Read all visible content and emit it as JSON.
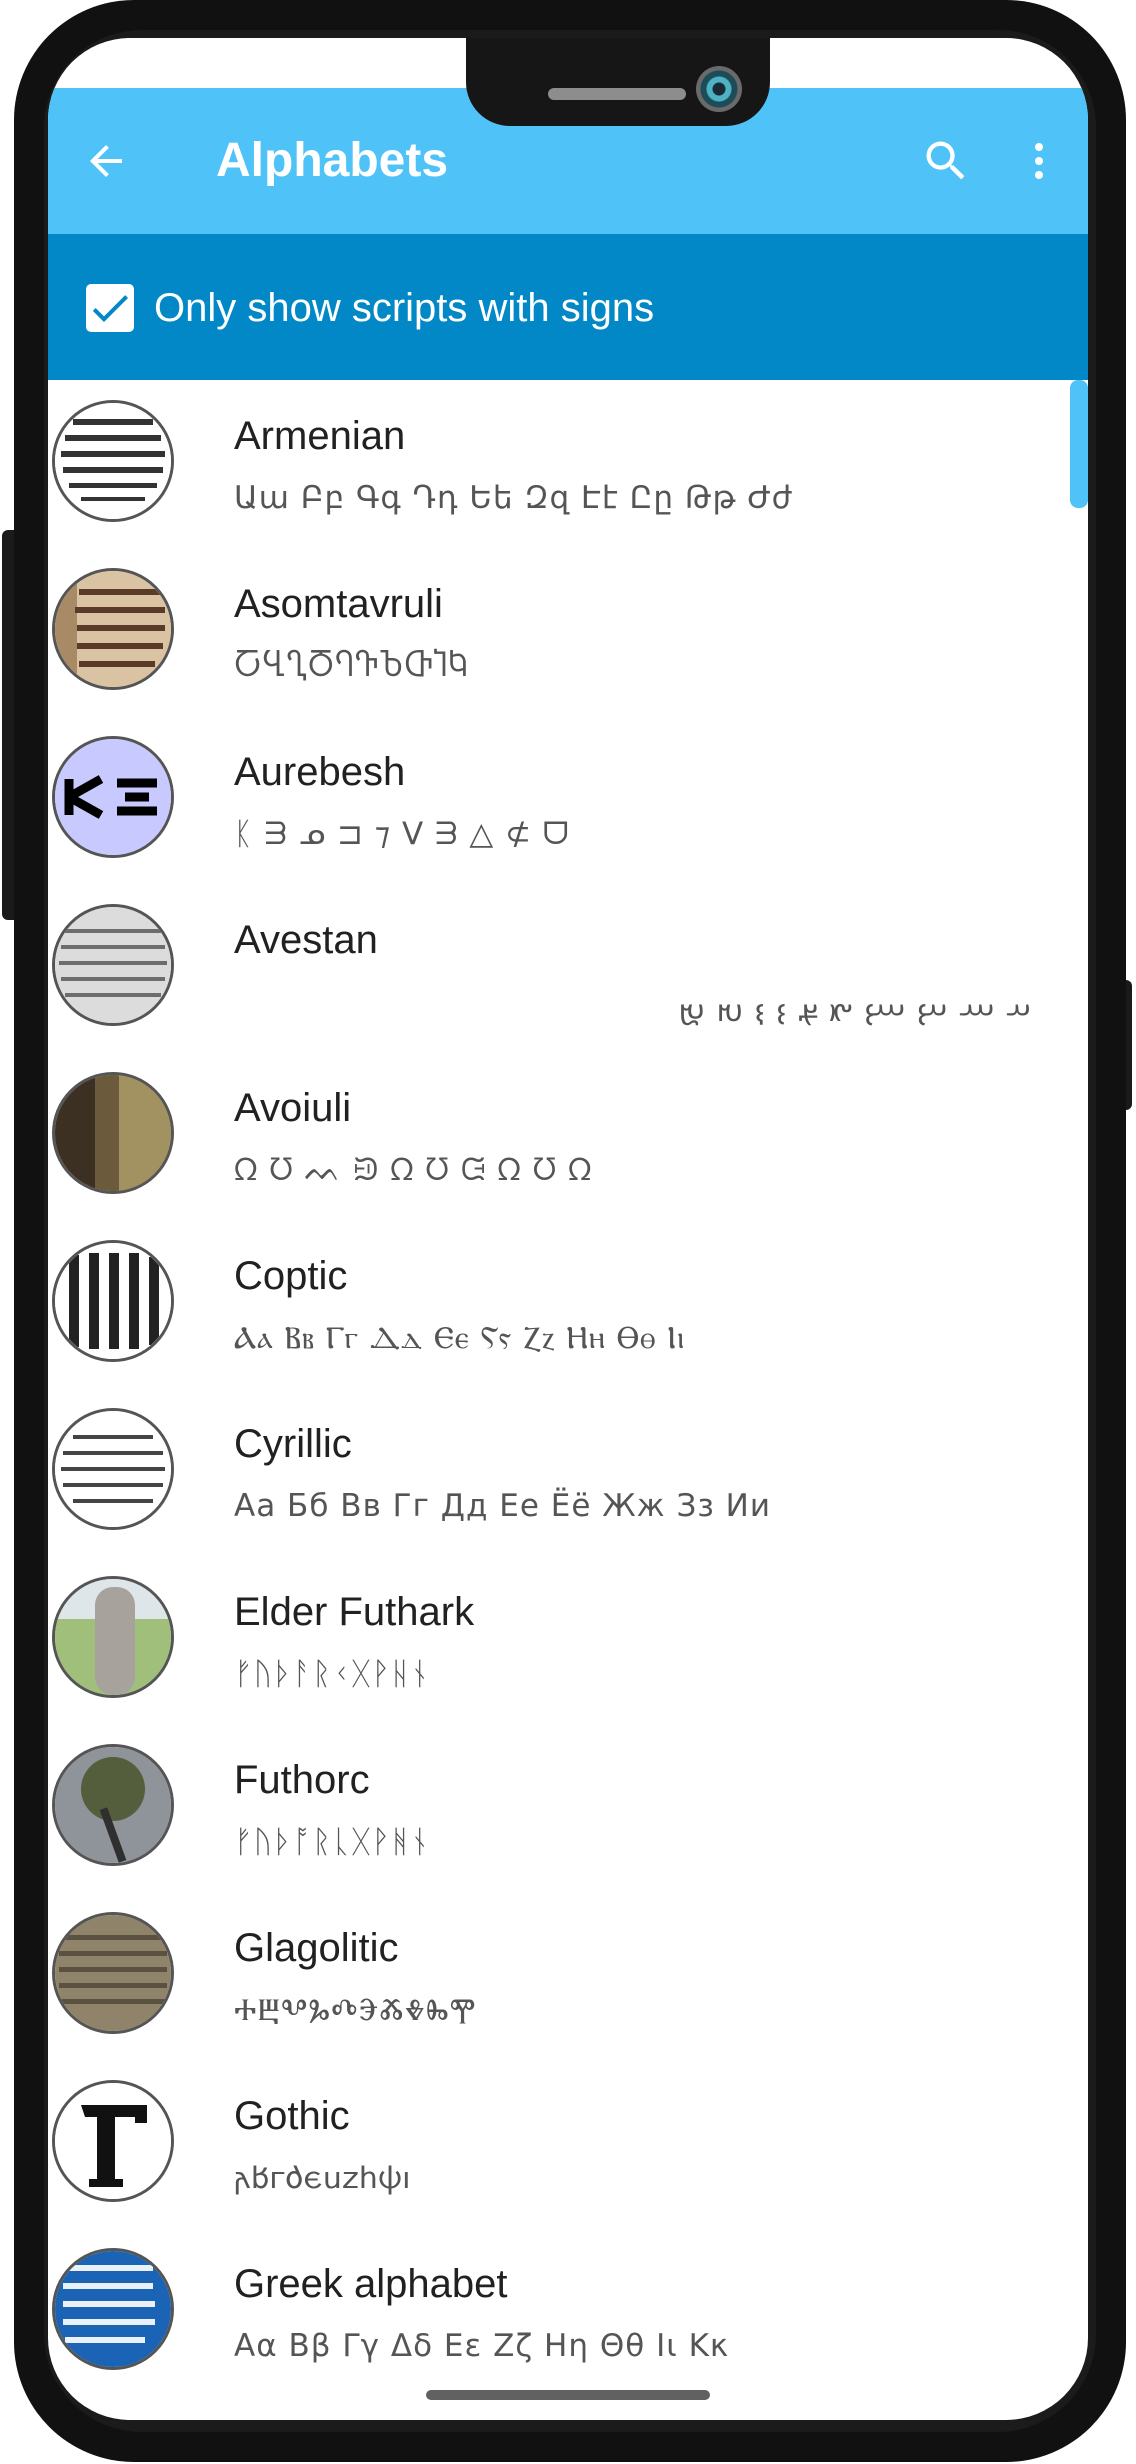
{
  "appbar": {
    "title": "Alphabets",
    "back_icon": "arrow-back-icon",
    "search_icon": "search-icon",
    "more_icon": "more-vert-icon",
    "color": "#4fc3f7"
  },
  "filter": {
    "label": "Only show scripts with signs",
    "checked": true,
    "color": "#0288c7"
  },
  "scripts": [
    {
      "name": "Armenian",
      "sample": "Աա Բբ Գգ Դդ Եե Զզ Էէ Ըը Թթ Ժժ"
    },
    {
      "name": "Asomtavruli",
      "sample": "ႠႡႢႣႤႥႦႧႨႩ"
    },
    {
      "name": "Aurebesh",
      "sample": "ᛕ ᗱ ᓄ ⊐ ⁊ ᐯ ᗱ △ ⊄ ᗜ"
    },
    {
      "name": "Avestan",
      "sample": "𐬀 𐬁 𐬂 𐬃 𐬄 𐬅 𐬆 𐬇 𐬈 𐬉"
    },
    {
      "name": "Avoiuli",
      "sample": "ᘯ ᘮ ᨓ ᙋ ᘯ ᘮ ᙍ ᘯ ᘮ ᘯ"
    },
    {
      "name": "Coptic",
      "sample": "Ⲁⲁ Ⲃⲃ Ⲅⲅ Ⲇⲇ Ⲉⲉ Ⲋⲋ Ⲍⲍ Ⲏⲏ Ⲑⲑ Ⲓⲓ"
    },
    {
      "name": "Cyrillic",
      "sample": "Аа Бб Вв Гг Дд Ее Ёё Жж Зз Ии"
    },
    {
      "name": "Elder Futhark",
      "sample": "ᚠᚢᚦᚨᚱᚲᚷᚹᚺᚾ"
    },
    {
      "name": "Futhorc",
      "sample": "ᚠᚢᚦᚩᚱᚳᚷᚹᚻᚾ"
    },
    {
      "name": "Glagolitic",
      "sample": "ⰀⰁⰂⰃⰄⰅⰆⰇⰈⰉ"
    },
    {
      "name": "Gothic",
      "sample": "𐌰𐌱𐌲𐌳𐌴𐌵𐌶𐌷𐌸𐌹"
    },
    {
      "name": "Greek alphabet",
      "sample": "Αα Ββ Γγ Δδ Εε Ζζ Ηη Θθ Ιι Κκ"
    }
  ]
}
